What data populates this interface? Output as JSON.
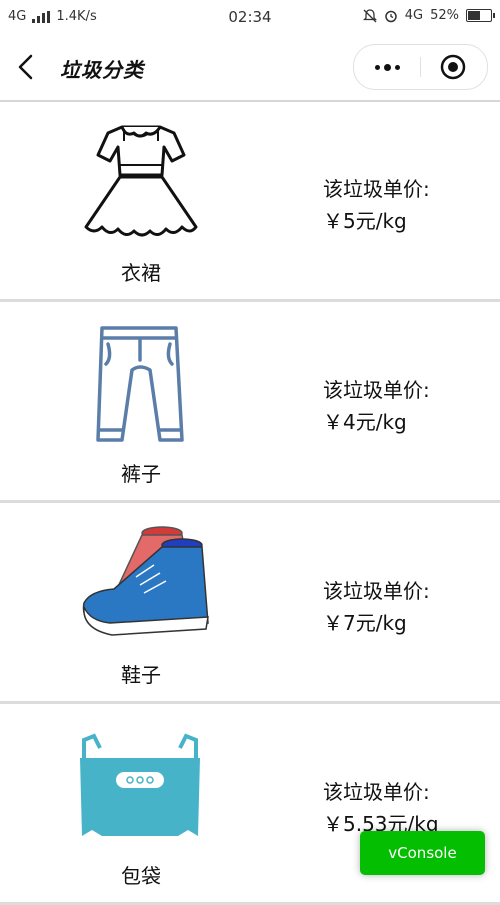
{
  "status_bar": {
    "network": "4G",
    "speed": "1.4K/s",
    "time": "02:34",
    "network_right": "4G",
    "battery": "52%"
  },
  "navbar": {
    "title": "垃圾分类",
    "icons": [
      "back-icon",
      "more-icon",
      "close-target-icon"
    ]
  },
  "items": [
    {
      "name": "衣裙",
      "price_label": "该垃圾单价:",
      "price": "￥5元/kg",
      "icon": "dress-icon"
    },
    {
      "name": "裤子",
      "price_label": "该垃圾单价:",
      "price": "￥4元/kg",
      "icon": "pants-icon"
    },
    {
      "name": "鞋子",
      "price_label": "该垃圾单价:",
      "price": "￥7元/kg",
      "icon": "shoes-icon"
    },
    {
      "name": "包袋",
      "price_label": "该垃圾单价:",
      "price": "￥5.53元/kg",
      "icon": "bag-icon"
    }
  ],
  "vconsole": {
    "label": "vConsole",
    "color": "#04be02"
  }
}
